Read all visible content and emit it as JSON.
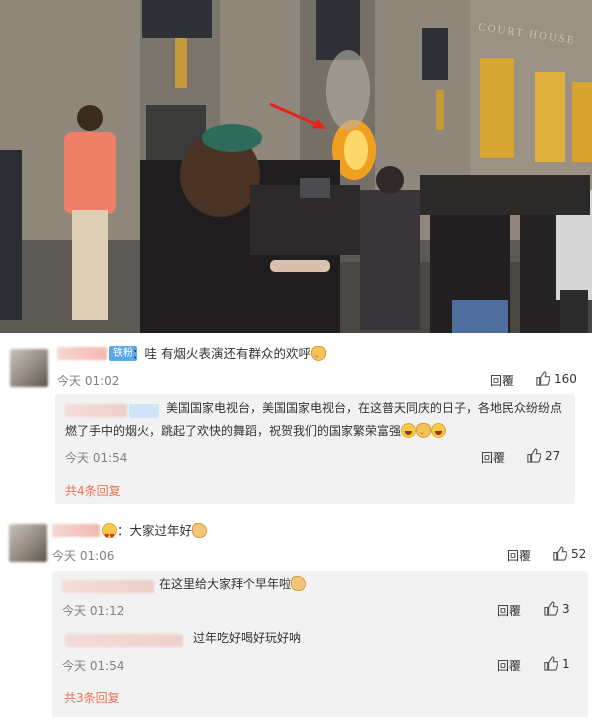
{
  "photo": {
    "sign_text": "COURT HOUSE"
  },
  "comments": [
    {
      "badge": "铁粉",
      "text": "：哇 有烟火表演还有群众的欢呼",
      "time": "今天 01:02",
      "reply_label": "回覆",
      "likes": "160",
      "replies": [
        {
          "text_line1": "美国国家电视台，美国国家电视台，在这普天同庆的日子，各地民众纷纷点",
          "text_line2": "燃了手中的烟火，跳起了欢快的舞蹈，祝贺我们的国家繁荣富强",
          "time": "今天 01:54",
          "reply_label": "回覆",
          "likes": "27"
        }
      ],
      "more_replies": "共4条回复"
    },
    {
      "text": "：大家过年好",
      "time": "今天 01:06",
      "reply_label": "回覆",
      "likes": "52",
      "replies": [
        {
          "text": "在这里给大家拜个早年啦",
          "time": "今天 01:12",
          "reply_label": "回覆",
          "likes": "3"
        },
        {
          "text": "过年吃好喝好玩好呐",
          "time": "今天 01:54",
          "reply_label": "回覆",
          "likes": "1"
        }
      ],
      "more_replies": "共3条回复"
    }
  ]
}
